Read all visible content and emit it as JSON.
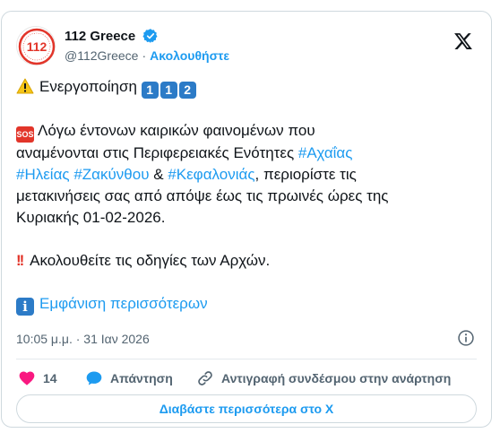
{
  "author": {
    "display_name": "112 Greece",
    "handle": "@112Greece",
    "follow_label": "Ακολουθήστε",
    "avatar_text": "112"
  },
  "tweet": {
    "line1_text": "Ενεργοποίηση",
    "line1_digits": [
      "1",
      "1",
      "2"
    ],
    "sos_label": "SOS",
    "p2_line1": "Λόγω έντονων καιρικών φαινομένων που",
    "p2_line2_prefix": "αναμένονται στις Περιφερειακές Ενότητες ",
    "hashtag_achaia": "#Αχαΐας",
    "hashtag_ilia": "#Ηλείας",
    "hashtag_zakynthos": "#Ζακύνθου",
    "ampersand": " & ",
    "hashtag_kefalonia": "#Κεφαλονιάς",
    "p2_line3_suffix": ", περιορίστε τις",
    "p2_line4": "μετακινήσεις σας από απόψε έως τις πρωινές ώρες της",
    "p2_line5": "Κυριακής 01-02-2026.",
    "p3_text": "Ακολουθείτε τις οδηγίες των Αρχών.",
    "show_more": "Εμφάνιση περισσότερων"
  },
  "timestamp": "10:05 μ.μ. · 31 Ιαν 2026",
  "actions": {
    "like_count": "14",
    "reply_label": "Απάντηση",
    "copy_link_label": "Αντιγραφή συνδέσμου στην ανάρτηση"
  },
  "read_more_label": "Διαβάστε περισσότερα στο X",
  "colors": {
    "accent": "#1d9bf0",
    "like": "#f91880",
    "text": "#0f1419",
    "secondary": "#536471",
    "border": "#cfd9de",
    "brand_red": "#e2352a"
  },
  "icons": {
    "verified": "verified-badge-icon",
    "x": "x-logo-icon",
    "warning": "warning-icon",
    "info": "info-icon",
    "like": "heart-icon",
    "reply": "speech-bubble-icon",
    "link": "link-icon"
  }
}
